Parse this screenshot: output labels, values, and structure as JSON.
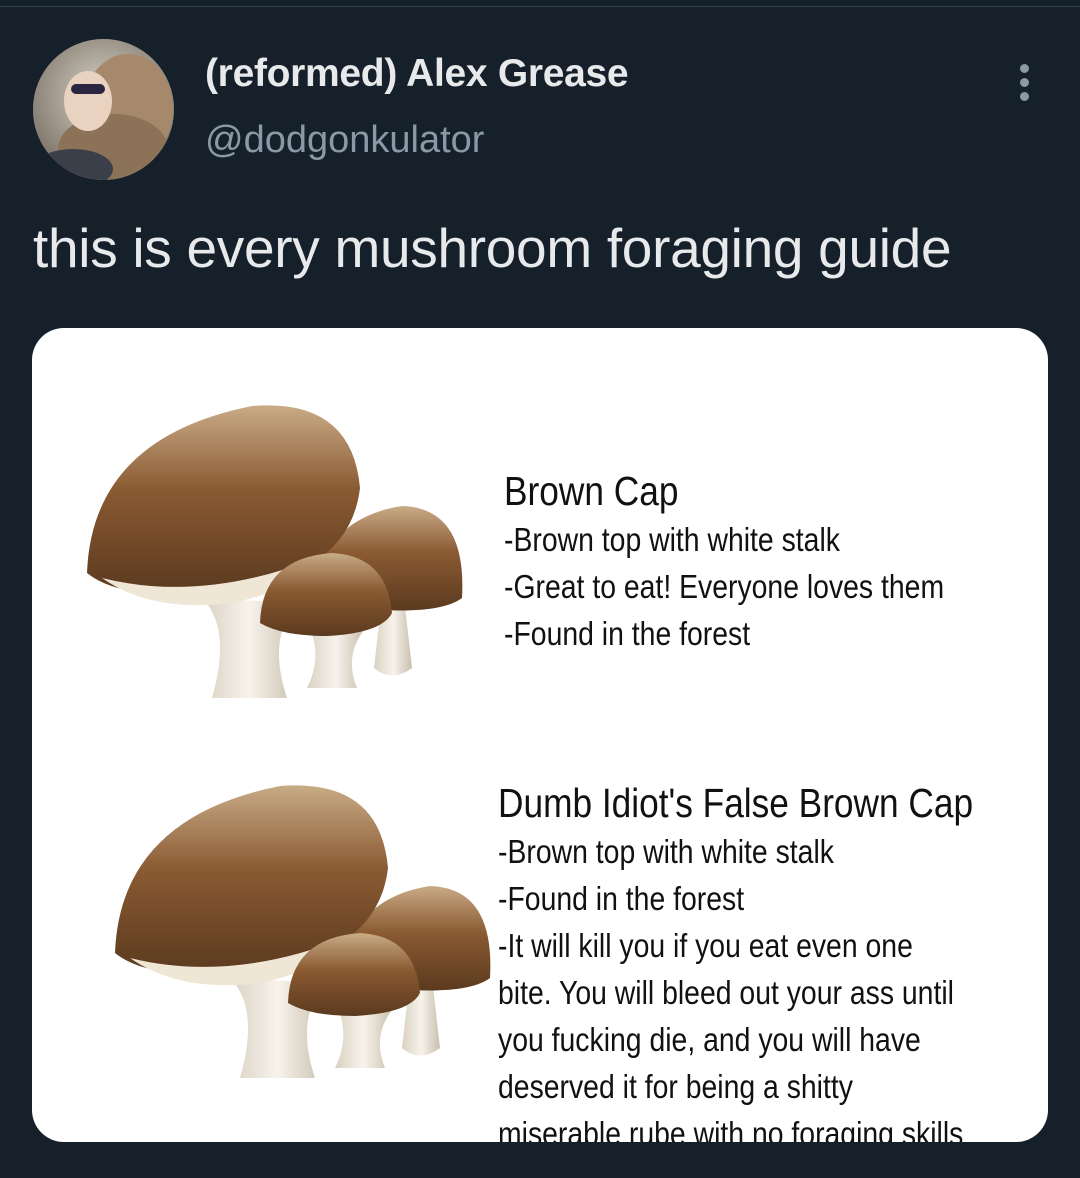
{
  "tweet": {
    "display_name": "(reformed) Alex Grease",
    "handle": "@dodgonkulator",
    "text": "this is every mushroom foraging guide",
    "more_icon": "more-vertical-icon"
  },
  "image": {
    "entries": [
      {
        "title": "Brown Cap",
        "lines": [
          "-Brown top with white stalk",
          "-Great to eat! Everyone loves them",
          "-Found in the forest"
        ]
      },
      {
        "title": "Dumb Idiot's False Brown Cap",
        "lines": [
          "-Brown top with white stalk",
          "-Found in the forest",
          "-It will kill you if you eat even one",
          "bite. You will bleed out your ass until",
          "you fucking die, and you will have",
          "deserved it for being a shitty",
          "miserable rube with no foraging skills"
        ]
      }
    ]
  },
  "colors": {
    "background": "#15202b",
    "primary_text": "#e7e9ea",
    "secondary_text": "#8b98a5",
    "mushroom_cap": "#8a5a32",
    "mushroom_stalk": "#efe9dd"
  }
}
